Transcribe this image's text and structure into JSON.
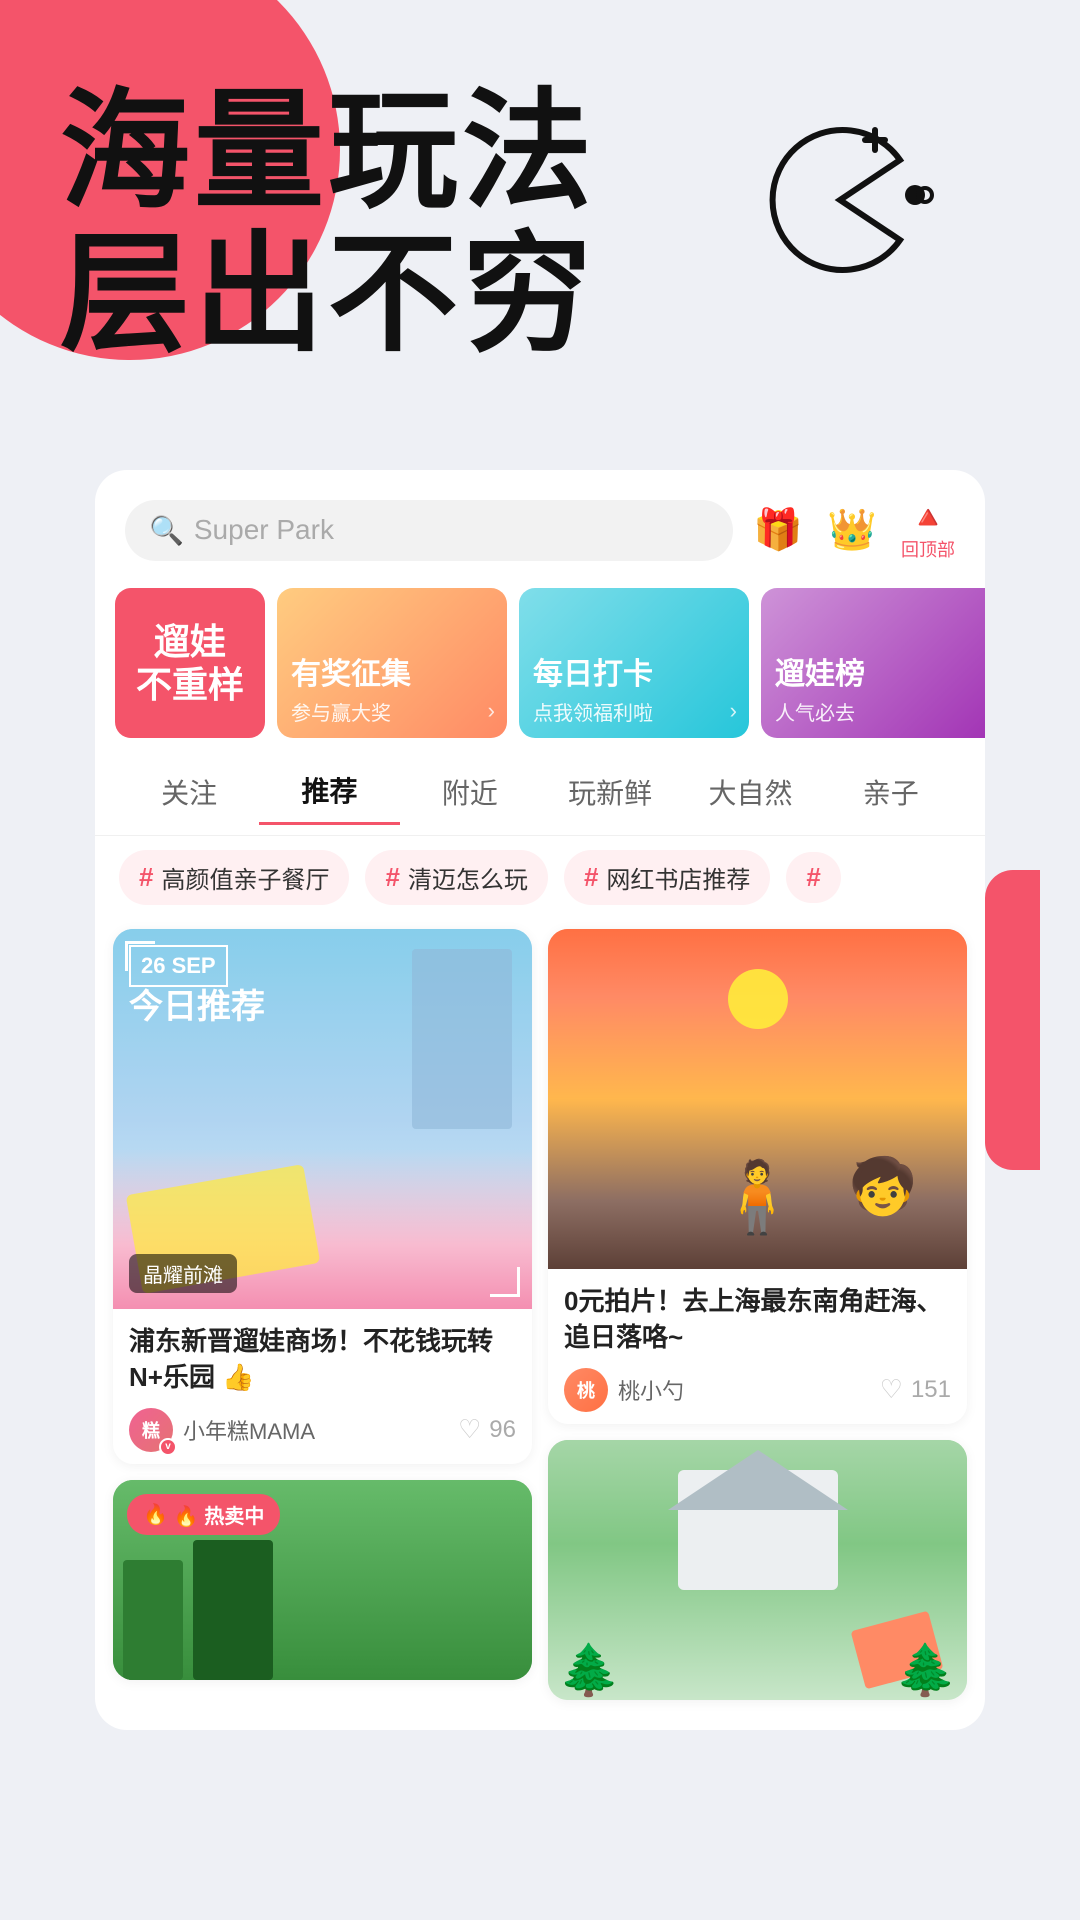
{
  "hero": {
    "title_line1": "海量玩法",
    "title_line2": "层出不穷"
  },
  "search": {
    "placeholder": "Super Park"
  },
  "header_icons": {
    "gift_icon": "🎁",
    "crown_icon": "👑",
    "back_top_label": "回顶部"
  },
  "banners": [
    {
      "id": "b1",
      "main_text": "遛娃\n不重样",
      "bg_color": "#f4546a",
      "type": "text"
    },
    {
      "id": "b2",
      "tag": "有奖征集",
      "sub": "参与赢大奖",
      "type": "img_warm"
    },
    {
      "id": "b3",
      "tag": "每日打卡",
      "sub": "点我领福利啦",
      "type": "img_cyan"
    },
    {
      "id": "b4",
      "tag": "遛娃榜",
      "sub": "人气必去",
      "type": "img_purple"
    }
  ],
  "nav_tabs": [
    {
      "id": "follow",
      "label": "关注",
      "active": false
    },
    {
      "id": "recommend",
      "label": "推荐",
      "active": true
    },
    {
      "id": "nearby",
      "label": "附近",
      "active": false
    },
    {
      "id": "new",
      "label": "玩新鲜",
      "active": false
    },
    {
      "id": "nature",
      "label": "大自然",
      "active": false
    },
    {
      "id": "family",
      "label": "亲子",
      "active": false
    }
  ],
  "tags": [
    {
      "id": "t1",
      "text": "高颜值亲子餐厅"
    },
    {
      "id": "t2",
      "text": "清迈怎么玩"
    },
    {
      "id": "t3",
      "text": "网红书店推荐"
    }
  ],
  "cards": {
    "col1": [
      {
        "id": "c1",
        "type": "featured",
        "date": "26 SEP",
        "today_label": "今日推荐",
        "location_badge": "晶耀前滩",
        "title": "浦东新晋遛娃商场！不花钱玩转N+乐园 👍",
        "author": "小年糕MAMA",
        "likes": "96",
        "img_type": "sky"
      },
      {
        "id": "c2",
        "type": "hotspot",
        "hot_label": "🔥 热卖中",
        "title": "",
        "img_type": "hotspot"
      }
    ],
    "col2": [
      {
        "id": "c3",
        "type": "normal",
        "title": "0元拍片！去上海最东南角赶海、追日落咯~",
        "author": "桃小勺",
        "likes": "151",
        "img_type": "sunset"
      },
      {
        "id": "c4",
        "type": "normal",
        "title": "",
        "author": "",
        "likes": "",
        "img_type": "nature"
      }
    ]
  }
}
